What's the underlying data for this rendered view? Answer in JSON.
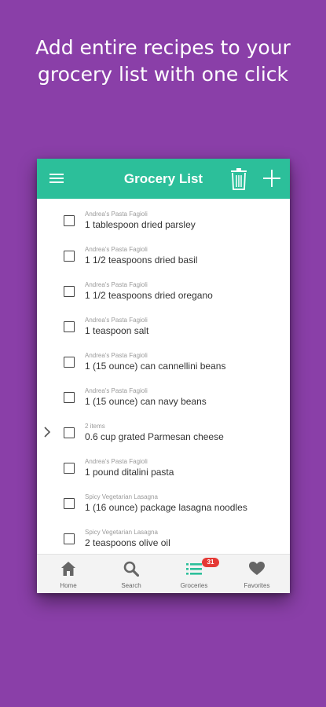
{
  "promo": {
    "line1": "Add entire recipes to your",
    "line2": "grocery list with one click"
  },
  "appbar": {
    "title": "Grocery List",
    "menu_icon": "hamburger-menu-icon",
    "trash_icon": "trash-icon",
    "add_icon": "plus-icon"
  },
  "items": [
    {
      "source": "Andrea's Pasta Fagioli",
      "text": "1 tablespoon dried parsley"
    },
    {
      "source": "Andrea's Pasta Fagioli",
      "text": "1 1/2 teaspoons dried basil"
    },
    {
      "source": "Andrea's Pasta Fagioli",
      "text": "1 1/2 teaspoons dried oregano"
    },
    {
      "source": "Andrea's Pasta Fagioli",
      "text": "1 teaspoon salt"
    },
    {
      "source": "Andrea's Pasta Fagioli",
      "text": "1 (15 ounce) can cannellini beans"
    },
    {
      "source": "Andrea's Pasta Fagioli",
      "text": "1 (15 ounce) can navy beans"
    },
    {
      "source": "2 items",
      "text": "0.6 cup grated Parmesan cheese",
      "expandable": true
    },
    {
      "source": "Andrea's Pasta Fagioli",
      "text": "1 pound ditalini pasta"
    },
    {
      "source": "Spicy Vegetarian Lasagna",
      "text": "1 (16 ounce) package lasagna noodles"
    },
    {
      "source": "Spicy Vegetarian Lasagna",
      "text": "2 teaspoons olive oil"
    }
  ],
  "bottom_nav": {
    "home": "Home",
    "search": "Search",
    "groceries": "Groceries",
    "groceries_badge": "31",
    "favorites": "Favorites"
  },
  "colors": {
    "background": "#8a3fa8",
    "accent": "#2cbf9a",
    "badge": "#e53935"
  }
}
